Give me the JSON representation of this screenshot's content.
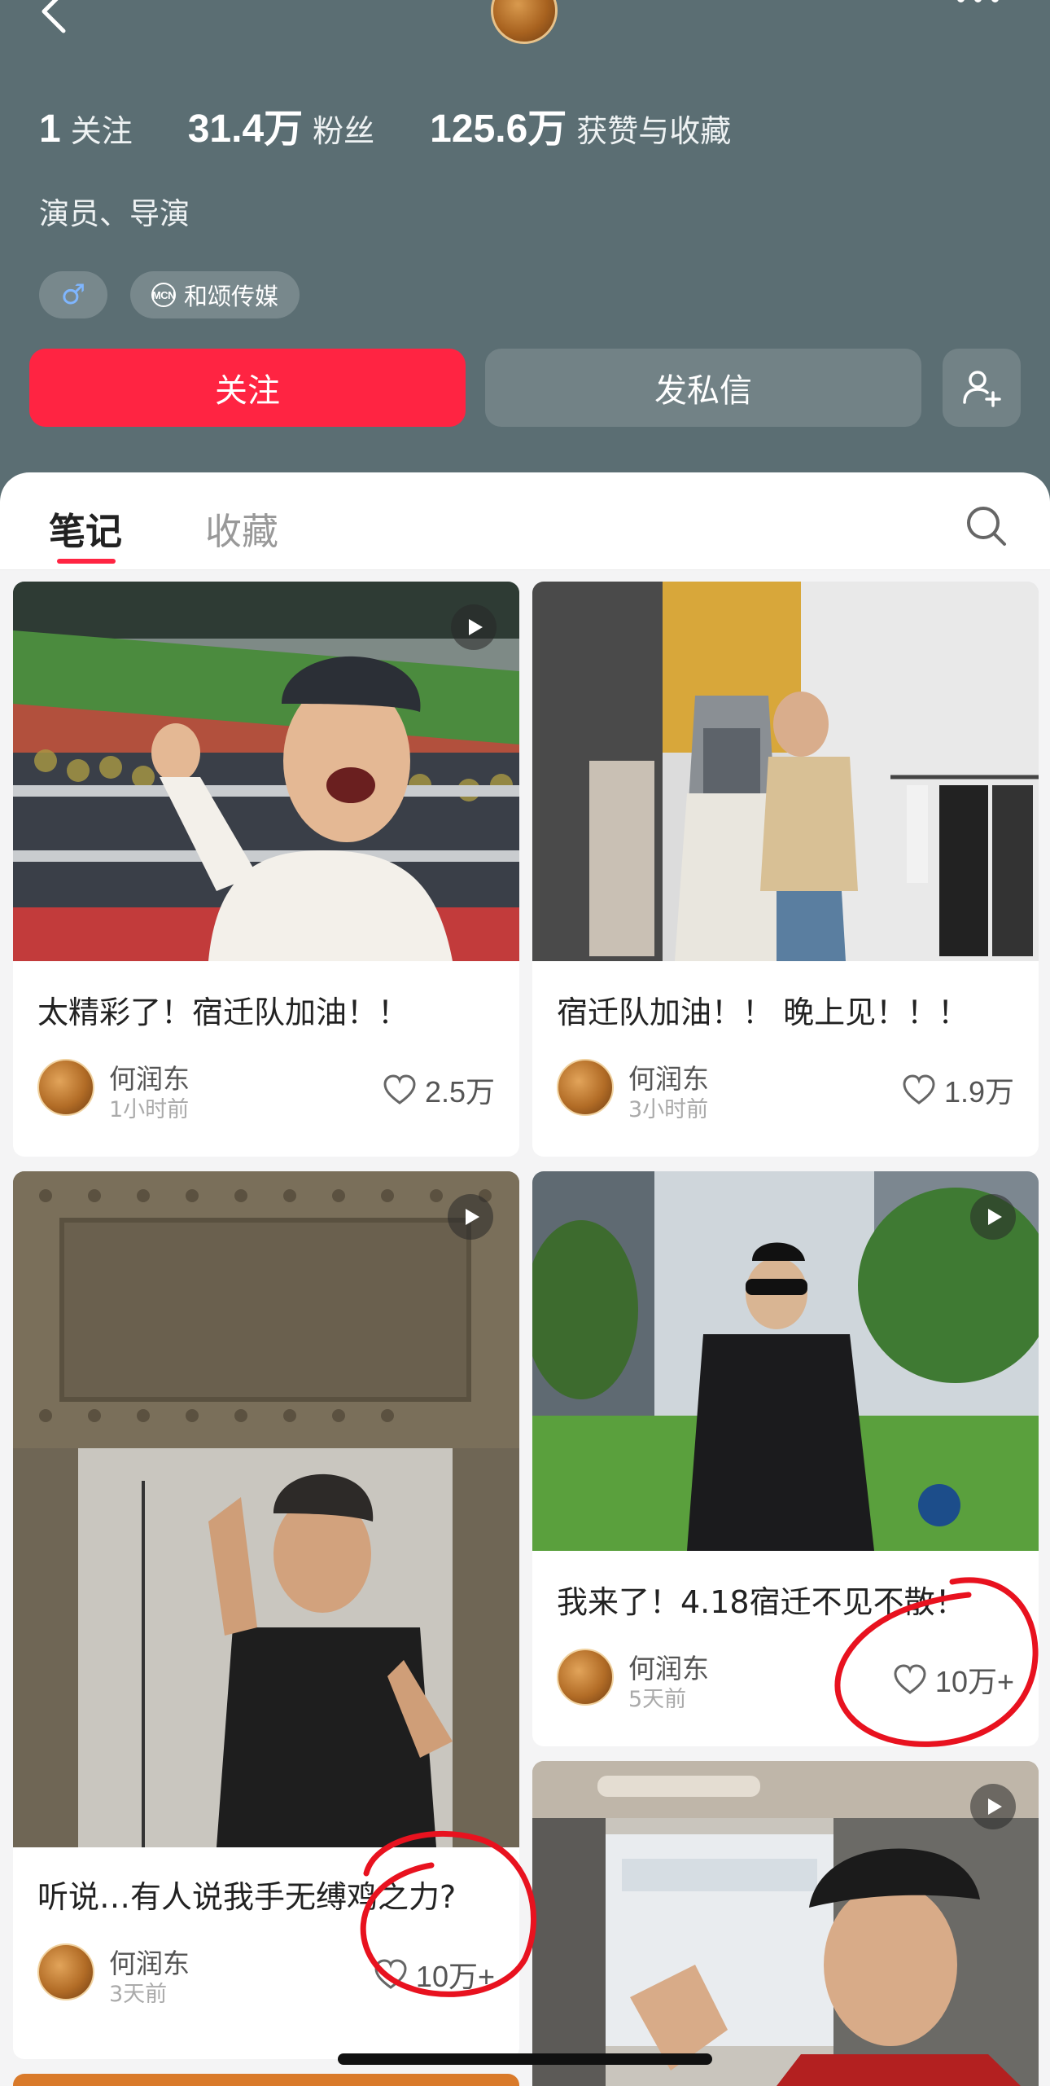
{
  "profile": {
    "stats": [
      {
        "value": "1",
        "label": "关注"
      },
      {
        "value": "31.4万",
        "label": "粉丝"
      },
      {
        "value": "125.6万",
        "label": "获赞与收藏"
      }
    ],
    "bio": "演员、导演",
    "tags": {
      "gender_symbol": "♂",
      "mcn_badge": "MCN",
      "mcn_label": "和颂传媒"
    },
    "follow_label": "关注",
    "message_label": "发私信"
  },
  "tabs": [
    {
      "label": "笔记",
      "active": true
    },
    {
      "label": "收藏",
      "active": false
    }
  ],
  "notes": [
    {
      "title": "太精彩了！宿迁队加油！！",
      "author": "何润东",
      "time": "1小时前",
      "likes": "2.5万"
    },
    {
      "title": "宿迁队加油！！ 晚上见！！！",
      "author": "何润东",
      "time": "3小时前",
      "likes": "1.9万"
    },
    {
      "title": "听说…有人说我手无缚鸡之力?",
      "author": "何润东",
      "time": "3天前",
      "likes": "10万+"
    },
    {
      "title": "我来了！4.18宿迁不见不散！",
      "author": "何润东",
      "time": "5天前",
      "likes": "10万+"
    }
  ],
  "colors": {
    "accent": "#ff2442",
    "header_bg": "#5b6e73",
    "annotation": "#e8121f"
  },
  "icons": [
    "back-arrow-icon",
    "more-dots-icon",
    "male-icon",
    "mcn-icon",
    "add-user-icon",
    "search-icon",
    "heart-icon",
    "play-icon"
  ]
}
